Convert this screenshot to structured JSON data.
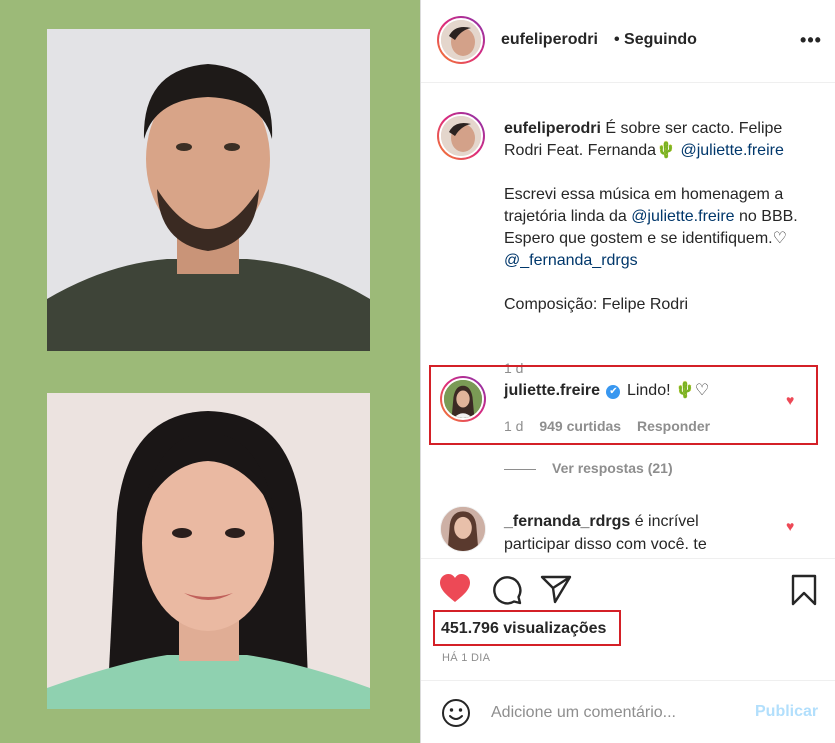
{
  "post": {
    "author": "eufeliperodri",
    "follow_status": "• Seguindo",
    "more_icon": "more-options-icon",
    "more_glyph": "•••"
  },
  "caption": {
    "username": "eufeliperodri",
    "line1": " É sobre ser cacto. Felipe Rodri Feat. Fernanda",
    "cactus": "🌵",
    "mention1": "@juliette.freire",
    "paragraph2_a": "Escrevi essa música em homenagem a trajetória linda da ",
    "mention2": "@juliette.freire",
    "paragraph2_b": " no BBB. Espero que gostem e se identifiquem.",
    "heart": "♡",
    "mention3": "@_fernanda_rdrgs",
    "paragraph3": "Composição: Felipe Rodri",
    "time": "1 d"
  },
  "comment1": {
    "username": "juliette.freire",
    "verified": "✔",
    "text": "Lindo! ",
    "cactus": "🌵",
    "heart": "♡",
    "time": "1 d",
    "likes": "949 curtidas",
    "reply": "Responder"
  },
  "view_replies": "Ver respostas (21)",
  "comment2": {
    "username": "_fernanda_rdrgs",
    "text": " é incrível participar disso com você. te"
  },
  "like_heart": "♥",
  "stats": {
    "views": "451.796 visualizações",
    "date": "HÁ 1 DIA"
  },
  "composer": {
    "placeholder": "Adicione um comentário...",
    "publish": "Publicar"
  },
  "colors": {
    "media_bg": "#9cba78",
    "like_red": "#ed4956",
    "highlight_red": "#d42027",
    "mention_blue": "#00376b",
    "publish_disabled": "#b2dffc"
  }
}
